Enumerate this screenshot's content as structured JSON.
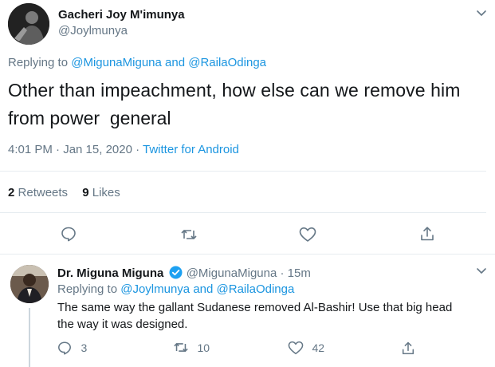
{
  "main_tweet": {
    "author_name": "Gacheri Joy M'imunya",
    "handle": "@Joylmunya",
    "replying_prefix": "Replying to",
    "replying_user1": "@MigunaMiguna",
    "replying_and": "and",
    "replying_user2": "@RailaOdinga",
    "text_line1": "Other than impeachment, how else can we remove him",
    "text_line2": "from power  general",
    "time": "4:01 PM · Jan 15, 2020",
    "separator": "·",
    "source": "Twitter for Android",
    "retweets_count": "2",
    "retweets_label": "Retweets",
    "likes_count": "9",
    "likes_label": "Likes"
  },
  "reply_tweet": {
    "author_name": "Dr. Miguna Miguna",
    "handle_time": "@MigunaMiguna · 15m",
    "replying_prefix": "Replying to",
    "replying_user1": "@Joylmunya",
    "replying_and": "and",
    "replying_user2": "@RailaOdinga",
    "text_line1": "The same way the gallant Sudanese removed Al-Bashir! Use that big head",
    "text_line2": "the way it was designed.",
    "reply_count": "3",
    "retweet_count": "10",
    "like_count": "42"
  },
  "colors": {
    "accent": "#1b95e0",
    "secondary_text": "#657786",
    "icon": "#657786",
    "divider": "#e6ecf0",
    "verified": "#1da1f2"
  },
  "icons": [
    "chevron-down-icon",
    "reply-icon",
    "retweet-icon",
    "like-icon",
    "share-icon",
    "verified-badge-icon"
  ]
}
